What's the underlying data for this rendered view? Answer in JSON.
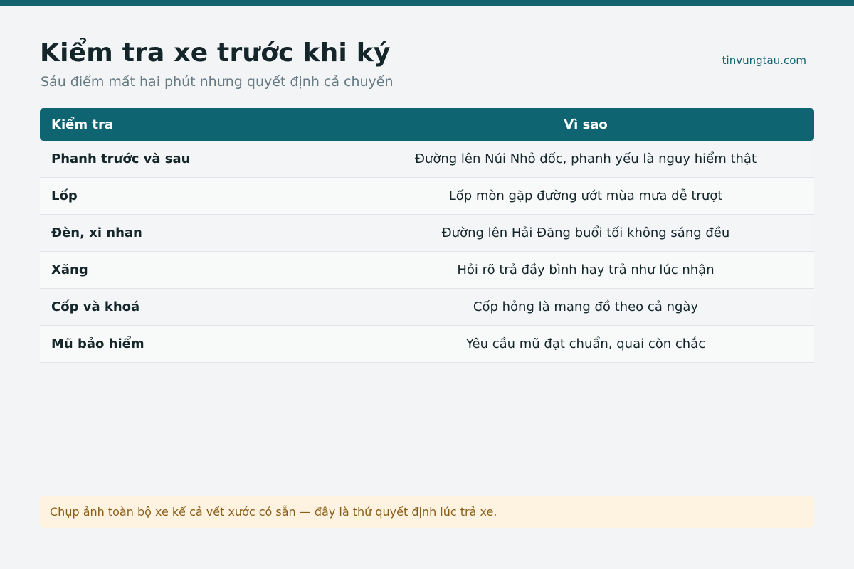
{
  "colors": {
    "accent": "#146470",
    "header_bg": "#0f6472",
    "note_bg": "#fdf3e0",
    "note_text": "#8a5c16"
  },
  "header": {
    "title": "Kiểm tra xe trước khi ký",
    "subtitle": "Sáu điểm mất hai phút nhưng quyết định cả chuyến",
    "site": "tinvungtau.com"
  },
  "table": {
    "columns": [
      "Kiểm tra",
      "Vì sao"
    ],
    "rows": [
      {
        "check": "Phanh trước và sau",
        "why": "Đường lên Núi Nhỏ dốc, phanh yếu là nguy hiểm thật"
      },
      {
        "check": "Lốp",
        "why": "Lốp mòn gặp đường ướt mùa mưa dễ trượt"
      },
      {
        "check": "Đèn, xi nhan",
        "why": "Đường lên Hải Đăng buổi tối không sáng đều"
      },
      {
        "check": "Xăng",
        "why": "Hỏi rõ trả đầy bình hay trả như lúc nhận"
      },
      {
        "check": "Cốp và khoá",
        "why": "Cốp hỏng là mang đồ theo cả ngày"
      },
      {
        "check": "Mũ bảo hiểm",
        "why": "Yêu cầu mũ đạt chuẩn, quai còn chắc"
      }
    ]
  },
  "note": "Chụp ảnh toàn bộ xe kể cả vết xước có sẵn — đây là thứ quyết định lúc trả xe."
}
